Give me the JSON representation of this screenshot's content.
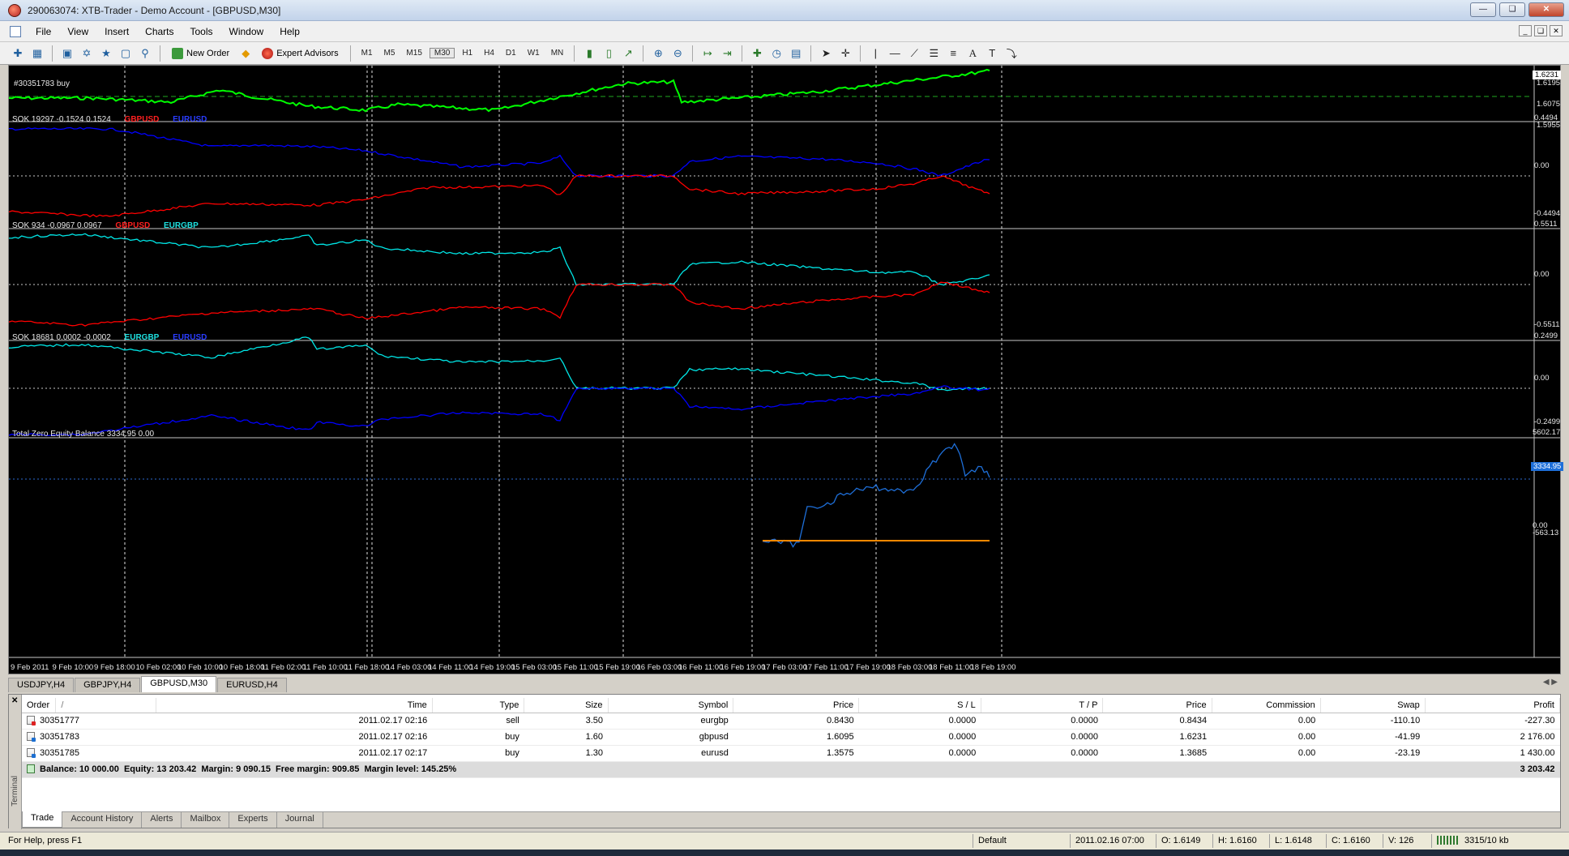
{
  "window": {
    "title": "290063074: XTB-Trader - Demo Account - [GBPUSD,M30]"
  },
  "menu": [
    "File",
    "View",
    "Insert",
    "Charts",
    "Tools",
    "Window",
    "Help"
  ],
  "toolbar": {
    "new_order_label": "New Order",
    "expert_advisors_label": "Expert Advisors",
    "timeframes": [
      "M1",
      "M5",
      "M15",
      "M30",
      "H1",
      "H4",
      "D1",
      "W1",
      "MN"
    ]
  },
  "chart": {
    "price_pane": {
      "order_label": "#30351783 buy",
      "axis_ticks": [
        "1.6195",
        "1.6075",
        "1.5955"
      ],
      "current_price": "1.6231"
    },
    "pane2": {
      "label": "SOK 19297 -0.1524 0.1524",
      "sym_a": "GBPUSD",
      "sym_b": "EURUSD",
      "axis_ticks": [
        "0.4494",
        "0.00",
        "-0.4494"
      ]
    },
    "pane3": {
      "label": "SOK 934 -0.0967 0.0967",
      "sym_a": "GBPUSD",
      "sym_b": "EURGBP",
      "axis_ticks": [
        "0.5511",
        "0.00",
        "-0.5511"
      ]
    },
    "pane4": {
      "label": "SOK 18681 0.0002 -0.0002",
      "sym_a": "EURGBP",
      "sym_b": "EURUSD",
      "axis_ticks": [
        "0.2499",
        "0.00",
        "-0.2499"
      ]
    },
    "pane5": {
      "label": "Total Zero Equity Balance 3334.95 0.00",
      "axis_ticks": [
        "5602.17",
        "0.00",
        "-563.13"
      ],
      "current_value": "3334.95"
    },
    "time_axis": [
      "9 Feb 2011",
      "9 Feb 10:00",
      "9 Feb 18:00",
      "10 Feb 02:00",
      "10 Feb 10:00",
      "10 Feb 18:00",
      "11 Feb 02:00",
      "11 Feb 10:00",
      "11 Feb 18:00",
      "14 Feb 03:00",
      "14 Feb 11:00",
      "14 Feb 19:00",
      "15 Feb 03:00",
      "15 Feb 11:00",
      "15 Feb 19:00",
      "16 Feb 03:00",
      "16 Feb 11:00",
      "16 Feb 19:00",
      "17 Feb 03:00",
      "17 Feb 11:00",
      "17 Feb 19:00",
      "18 Feb 03:00",
      "18 Feb 11:00",
      "18 Feb 19:00"
    ],
    "colors": {
      "candles": "#00ff00",
      "gbpusd": "#ff0000",
      "eurusd": "#0000ff",
      "eurgbp": "#00e5e5",
      "equity": "#1e6fd9",
      "balance": "#ff8800"
    }
  },
  "chart_tabs": [
    {
      "label": "USDJPY,H4",
      "active": false
    },
    {
      "label": "GBPJPY,H4",
      "active": false
    },
    {
      "label": "GBPUSD,M30",
      "active": true
    },
    {
      "label": "EURUSD,H4",
      "active": false
    }
  ],
  "orders": {
    "columns": [
      "Order",
      "/",
      "Time",
      "Type",
      "Size",
      "Symbol",
      "Price",
      "S / L",
      "T / P",
      "Price",
      "Commission",
      "Swap",
      "Profit"
    ],
    "rows": [
      {
        "order": "30351777",
        "time": "2011.02.17 02:16",
        "type": "sell",
        "size": "3.50",
        "symbol": "eurgbp",
        "price": "0.8430",
        "sl": "0.0000",
        "tp": "0.0000",
        "cur_price": "0.8434",
        "commission": "0.00",
        "swap": "-110.10",
        "profit": "-227.30"
      },
      {
        "order": "30351783",
        "time": "2011.02.17 02:16",
        "type": "buy",
        "size": "1.60",
        "symbol": "gbpusd",
        "price": "1.6095",
        "sl": "0.0000",
        "tp": "0.0000",
        "cur_price": "1.6231",
        "commission": "0.00",
        "swap": "-41.99",
        "profit": "2 176.00"
      },
      {
        "order": "30351785",
        "time": "2011.02.17 02:17",
        "type": "buy",
        "size": "1.30",
        "symbol": "eurusd",
        "price": "1.3575",
        "sl": "0.0000",
        "tp": "0.0000",
        "cur_price": "1.3685",
        "commission": "0.00",
        "swap": "-23.19",
        "profit": "1 430.00"
      }
    ],
    "balance_line": "Balance: 10 000.00  Equity: 13 203.42  Margin: 9 090.15  Free margin: 909.85  Margin level: 145.25%",
    "total_profit": "3 203.42"
  },
  "terminal": {
    "side_label": "Terminal",
    "tabs": [
      {
        "label": "Trade",
        "active": true
      },
      {
        "label": "Account History",
        "active": false
      },
      {
        "label": "Alerts",
        "active": false
      },
      {
        "label": "Mailbox",
        "active": false
      },
      {
        "label": "Experts",
        "active": false
      },
      {
        "label": "Journal",
        "active": false
      }
    ]
  },
  "status": {
    "help": "For Help, press F1",
    "profile": "Default",
    "datetime": "2011.02.16 07:00",
    "open": "O: 1.6149",
    "high": "H: 1.6160",
    "low": "L: 1.6148",
    "close": "C: 1.6160",
    "volume": "V: 126",
    "traffic": "3315/10 kb"
  }
}
